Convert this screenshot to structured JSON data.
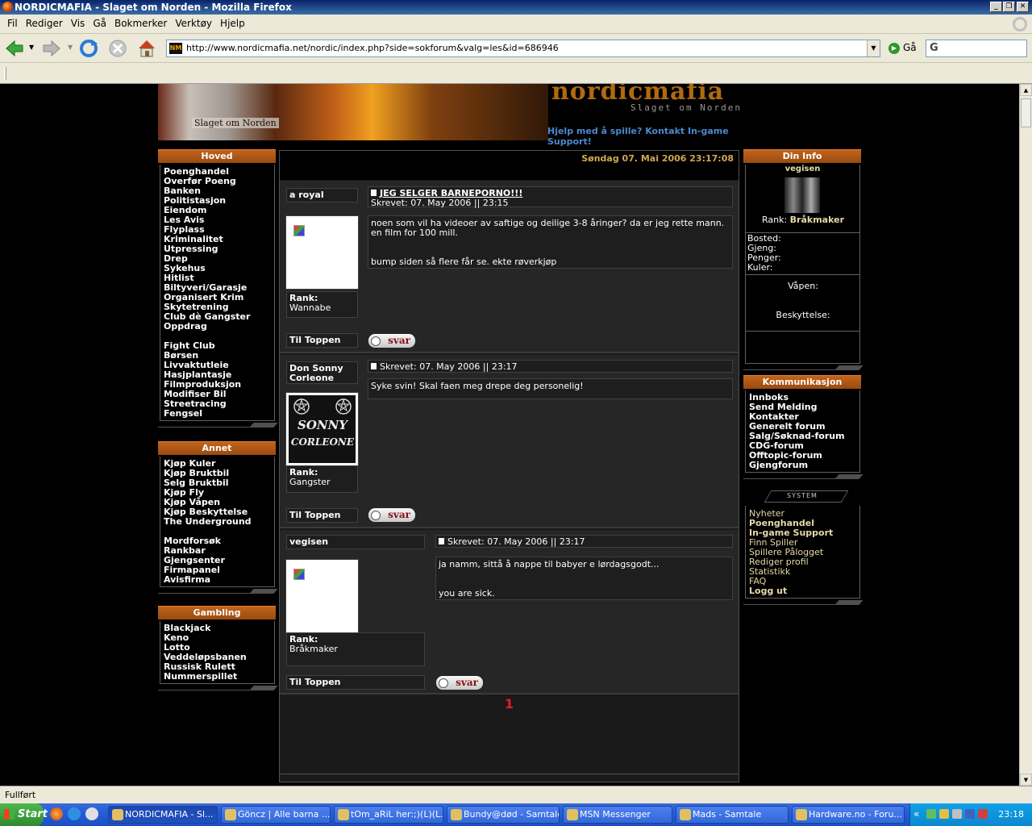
{
  "window": {
    "title": "NORDICMAFIA - Slaget om Norden - Mozilla Firefox"
  },
  "menu": [
    "Fil",
    "Rediger",
    "Vis",
    "Gå",
    "Bokmerker",
    "Verktøy",
    "Hjelp"
  ],
  "nav": {
    "url": "http://www.nordicmafia.net/nordic/index.php?side=sokforum&valg=les&id=686946",
    "favicon": "NM",
    "go_label": "Gå",
    "search_logo": "G"
  },
  "banner": {
    "logo": "nordicmafia",
    "subtitle": "Slaget om Norden",
    "img_text": "Slaget om Norden",
    "help": "Hjelp med å spille? Kontakt In-game Support!"
  },
  "left": {
    "hoved": {
      "title": "Hoved",
      "items": [
        "Poenghandel",
        "Overfør Poeng",
        "Banken",
        "Politistasjon",
        "Eiendom",
        "Les Avis",
        "Flyplass",
        "Kriminalitet",
        "Utpressing",
        "Drep",
        "Sykehus",
        "Hitlist",
        "Biltyveri/Garasje",
        "Organisert Krim",
        "Skytetrening",
        "Club dè Gangster",
        "Oppdrag"
      ],
      "items2": [
        "Fight Club",
        "Børsen",
        "Livvaktutleie",
        "Hasjplantasje",
        "Filmproduksjon",
        "Modifiser Bil",
        "Streetracing",
        "Fengsel"
      ]
    },
    "annet": {
      "title": "Annet",
      "items": [
        "Kjøp Kuler",
        "Kjøp Bruktbil",
        "Selg Bruktbil",
        "Kjøp Fly",
        "Kjøp Våpen",
        "Kjøp Beskyttelse",
        "The Underground"
      ],
      "items2": [
        "Mordforsøk",
        "Rankbar",
        "Gjengsenter",
        "Firmapanel",
        "Avisfirma"
      ]
    },
    "gambling": {
      "title": "Gambling",
      "items": [
        "Blackjack",
        "Keno",
        "Lotto",
        "Veddeløpsbanen",
        "Russisk Rulett",
        "Nummerspillet"
      ]
    }
  },
  "center": {
    "date": "Søndag 07. Mai 2006 23:17:08",
    "posts": [
      {
        "author": "a royal",
        "title": "JEG SELGER BARNEPORNO!!!",
        "written": "Skrevet: 07. May 2006 || 23:15",
        "body": "noen som vil ha videoer av saftige og deilige 3-8 åringer? da er jeg rette mann.\nen film for 100 mill.\n\n\nbump siden så flere får se. ekte røverkjøp",
        "rank_label": "Rank:",
        "rank": "Wannabe",
        "top": "Til Toppen",
        "reply": "svar"
      },
      {
        "author": "Don Sonny Corleone",
        "written": "Skrevet: 07. May 2006 || 23:17",
        "body": "Syke svin! Skal faen meg drepe deg personelig!",
        "rank_label": "Rank:",
        "rank": "Gangster",
        "top": "Til Toppen",
        "reply": "svar",
        "avatar_text": "SONNY CORLEONE"
      },
      {
        "author": "vegisen",
        "written": "Skrevet: 07. May 2006 || 23:17",
        "body": "ja namm, sittå å nappe til babyer e lørdagsgodt...\n\n\nyou are sick.",
        "rank_label": "Rank:",
        "rank": "Bråkmaker",
        "top": "Til Toppen",
        "reply": "svar"
      }
    ],
    "page": "1"
  },
  "right": {
    "info": {
      "title": "Din Info",
      "user": "vegisen",
      "rank_label": "Rank:",
      "rank": "Bråkmaker",
      "fields": [
        "Bosted:",
        "Gjeng:",
        "Penger:",
        "Kuler:"
      ],
      "weapon": "Våpen:",
      "protection": "Beskyttelse:"
    },
    "komm": {
      "title": "Kommunikasjon",
      "items": [
        "Innboks",
        "Send Melding",
        "Kontakter",
        "Generelt forum",
        "Salg/Søknad-forum",
        "CDG-forum",
        "Offtopic-forum",
        "Gjengforum"
      ]
    },
    "system": {
      "title": "SYSTEM",
      "items": [
        {
          "label": "Nyheter",
          "bold": false
        },
        {
          "label": "Poenghandel",
          "bold": true
        },
        {
          "label": "In-game Support",
          "bold": true
        },
        {
          "label": "Finn Spiller",
          "bold": false
        },
        {
          "label": "Spillere Pålogget",
          "bold": false
        },
        {
          "label": "Rediger profil",
          "bold": false
        },
        {
          "label": "Statistikk",
          "bold": false
        },
        {
          "label": "FAQ",
          "bold": false
        },
        {
          "label": "Logg ut",
          "bold": true
        }
      ]
    }
  },
  "status": "Fullført",
  "taskbar": {
    "start": "Start",
    "tasks": [
      "NORDICMAFIA - Sl...",
      "Göncz | Alle barna ...",
      "tOm_aRiL her:;)(L)(L...",
      "Bundy@død - Samtale",
      "MSN Messenger",
      "Mads - Samtale",
      "Hardware.no - Foru..."
    ],
    "tray_arrow": "«",
    "clock": "23:18"
  }
}
